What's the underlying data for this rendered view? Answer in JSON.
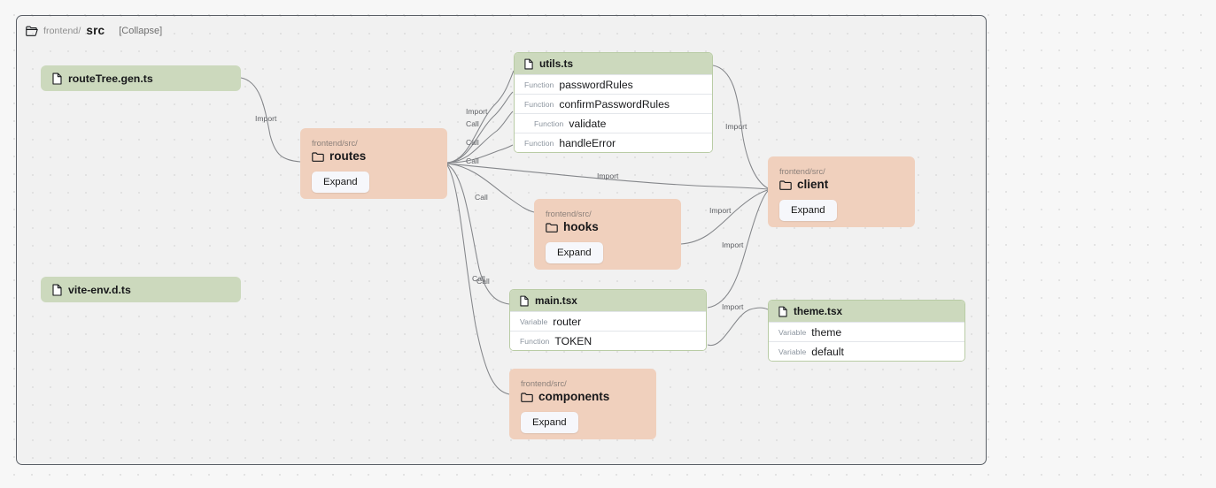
{
  "breadcrumb": {
    "icon": "folder-open-icon",
    "prefix": "frontend/",
    "name": "src",
    "collapse_label": "[Collapse]"
  },
  "colors": {
    "folder_node_bg": "#f0d0bd",
    "file_header_bg": "#ccd9bd",
    "file_card_border": "#b9cca5",
    "canvas_bg": "#f1f1f1",
    "frame_border": "#5a5f66",
    "edge_stroke": "#84868a",
    "kind_text": "#8b949e"
  },
  "nodes": {
    "route_tree": {
      "icon": "file-icon",
      "name": "routeTree.gen.ts"
    },
    "vite_env": {
      "icon": "file-icon",
      "name": "vite-env.d.ts"
    },
    "routes": {
      "icon": "folder-icon",
      "path": "frontend/src/",
      "name": "routes",
      "expand_label": "Expand"
    },
    "hooks": {
      "icon": "folder-icon",
      "path": "frontend/src/",
      "name": "hooks",
      "expand_label": "Expand"
    },
    "client": {
      "icon": "folder-icon",
      "path": "frontend/src/",
      "name": "client",
      "expand_label": "Expand"
    },
    "components": {
      "icon": "folder-icon",
      "path": "frontend/src/",
      "name": "components",
      "expand_label": "Expand"
    },
    "utils": {
      "icon": "file-icon",
      "name": "utils.ts",
      "members": [
        {
          "kind": "Function",
          "label": "passwordRules",
          "indent": false
        },
        {
          "kind": "Function",
          "label": "confirmPasswordRules",
          "indent": false
        },
        {
          "kind": "Function",
          "label": "validate",
          "indent": true
        },
        {
          "kind": "Function",
          "label": "handleError",
          "indent": false
        }
      ]
    },
    "main": {
      "icon": "file-icon",
      "name": "main.tsx",
      "members": [
        {
          "kind": "Variable",
          "label": "router",
          "indent": false
        },
        {
          "kind": "Function",
          "label": "TOKEN",
          "indent": false
        }
      ]
    },
    "theme": {
      "icon": "file-icon",
      "name": "theme.tsx",
      "members": [
        {
          "kind": "Variable",
          "label": "theme",
          "indent": false
        },
        {
          "kind": "Variable",
          "label": "default",
          "indent": false
        }
      ]
    }
  },
  "edges": [
    {
      "id": "e1",
      "label": "Import",
      "from": "routeTree.gen.ts",
      "to": "routes"
    },
    {
      "id": "e2",
      "label": "Import",
      "from": "routes",
      "to": "utils.ts"
    },
    {
      "id": "e3",
      "label": "Call",
      "from": "routes",
      "to": "passwordRules"
    },
    {
      "id": "e4",
      "label": "Call",
      "from": "routes",
      "to": "confirmPasswordRules"
    },
    {
      "id": "e5",
      "label": "Call",
      "from": "routes",
      "to": "handleError"
    },
    {
      "id": "e6",
      "label": "Call",
      "from": "routes",
      "to": "hooks"
    },
    {
      "id": "e7",
      "label": "Import",
      "from": "routes",
      "to": "client"
    },
    {
      "id": "e8",
      "label": "Call",
      "from": "routes",
      "to": "main.tsx"
    },
    {
      "id": "e9",
      "label": "Call",
      "from": "routes",
      "to": "components"
    },
    {
      "id": "e10",
      "label": "Import",
      "from": "utils.ts",
      "to": "client"
    },
    {
      "id": "e11",
      "label": "Import",
      "from": "hooks",
      "to": "client"
    },
    {
      "id": "e12",
      "label": "Import",
      "from": "main.tsx",
      "to": "client"
    },
    {
      "id": "e13",
      "label": "Import",
      "from": "main.tsx",
      "to": "theme.tsx"
    }
  ]
}
